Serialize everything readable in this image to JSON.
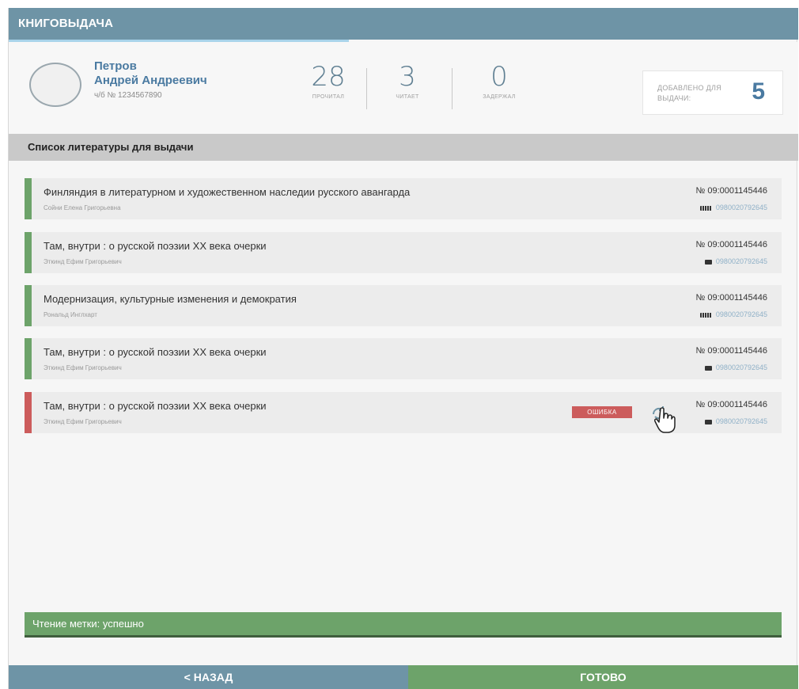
{
  "app": {
    "title": "КНИГОВЫДАЧА"
  },
  "user": {
    "last_name": "Петров",
    "first_middle": "Андрей Андреевич",
    "card": "ч/б № 1234567890"
  },
  "stats": [
    {
      "value": "28",
      "label": "ПРОЧИТАЛ"
    },
    {
      "value": "3",
      "label": "ЧИТАЕТ"
    },
    {
      "value": "0",
      "label": "ЗАДЕРЖАЛ"
    }
  ],
  "added": {
    "label": "ДОБАВЛЕНО ДЛЯ ВЫДАЧИ:",
    "count": "5"
  },
  "section": {
    "title": "Список литературы для выдачи"
  },
  "books": [
    {
      "title": "Финляндия в литературном и художественном наследии русского авангарда",
      "author": "Сойни Елена Григорьевна",
      "inventory": "№ 09:0001145446",
      "barcode": "0980020792645",
      "status": "ok",
      "code_icon": "barcode-icon"
    },
    {
      "title": "Там, внутри : о русской поэзии XX века очерки",
      "author": "Эткинд Ефим Григорьевич",
      "inventory": "№ 09:0001145446",
      "barcode": "0980020792645",
      "status": "ok",
      "code_icon": "rfid-tag-icon"
    },
    {
      "title": "Модернизация, культурные изменения и демократия",
      "author": "Рональд Инглхарт",
      "inventory": "№ 09:0001145446",
      "barcode": "0980020792645",
      "status": "ok",
      "code_icon": "barcode-icon"
    },
    {
      "title": "Там, внутри : о русской поэзии XX века очерки",
      "author": "Эткинд Ефим Григорьевич",
      "inventory": "№ 09:0001145446",
      "barcode": "0980020792645",
      "status": "ok",
      "code_icon": "rfid-tag-icon"
    },
    {
      "title": "Там, внутри : о русской поэзии XX века очерки",
      "author": "Эткинд Ефим Григорьевич",
      "inventory": "№ 09:0001145446",
      "barcode": "0980020792645",
      "status": "error",
      "code_icon": "rfid-tag-icon",
      "error_label": "ОШИБКА",
      "action_icon": "refresh-icon"
    }
  ],
  "status_bar": {
    "text": "Чтение метки: успешно"
  },
  "buttons": {
    "back": "< НАЗАД",
    "done": "ГОТОВО"
  },
  "colors": {
    "header": "#6e94a6",
    "success": "#6da36a",
    "error": "#cc5c5c",
    "accent": "#4a7aa1"
  }
}
